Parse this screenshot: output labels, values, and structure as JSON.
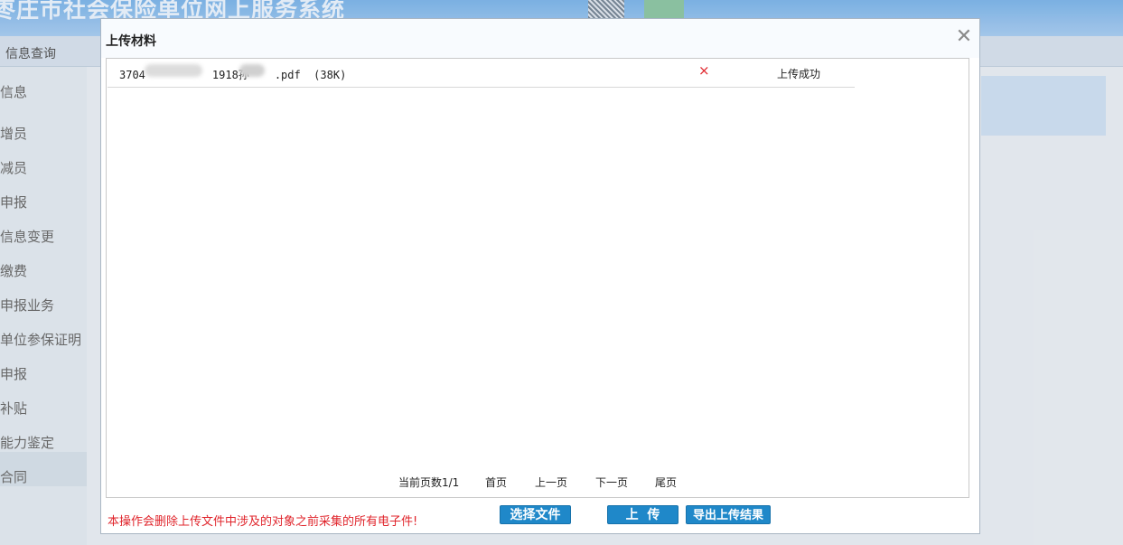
{
  "app": {
    "title": "枣庄市社会保险单位网上服务系统",
    "header_right": "",
    "nav": {
      "active_label": "信息查询"
    },
    "sidebar": [
      {
        "label": "信息"
      },
      {
        "label": "增员"
      },
      {
        "label": "减员"
      },
      {
        "label": "申报"
      },
      {
        "label": "信息变更"
      },
      {
        "label": "缴费"
      },
      {
        "label": "申报业务"
      },
      {
        "label": "单位参保证明"
      },
      {
        "label": "申报"
      },
      {
        "label": "补贴"
      },
      {
        "label": "能力鉴定"
      },
      {
        "label": "合同"
      }
    ]
  },
  "modal": {
    "title": "上传材料",
    "close_glyph": "✕",
    "files": [
      {
        "name_prefix": "3704",
        "name_mid": "1918孙",
        "name_suffix": ".pdf",
        "size": "(38K)",
        "delete_glyph": "×",
        "status": "上传成功"
      }
    ],
    "pager": {
      "info": "当前页数1/1",
      "first": "首页",
      "prev": "上一页",
      "next": "下一页",
      "last": "尾页"
    },
    "warning": "本操作会删除上传文件中涉及的对象之前采集的所有电子件!",
    "buttons": {
      "select": "选择文件",
      "upload": "上  传",
      "export": "导出上传结果"
    }
  },
  "colors": {
    "accent": "#1f88c9",
    "danger": "#e0242b",
    "header": "#7fb6ea"
  }
}
